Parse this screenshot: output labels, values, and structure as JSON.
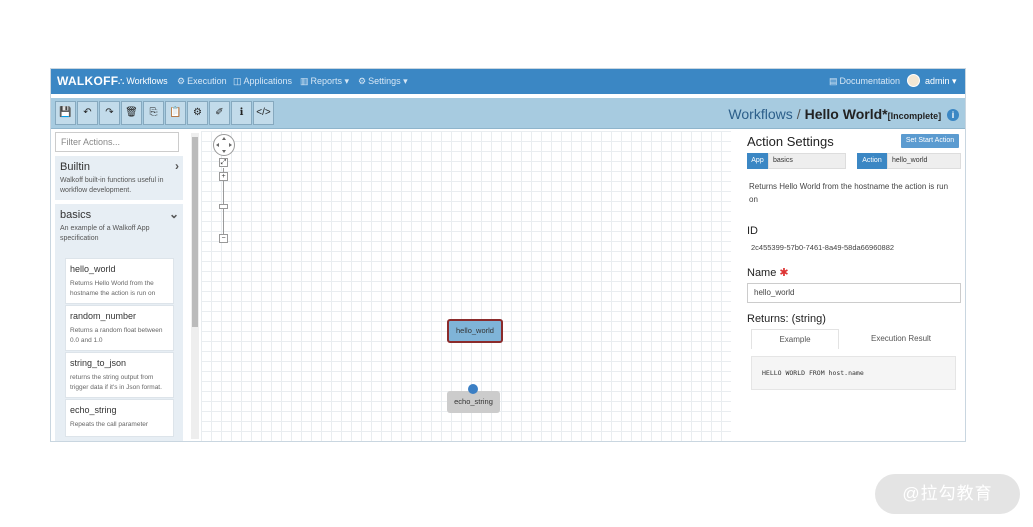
{
  "navbar": {
    "brand": "WALKOFF",
    "items": [
      {
        "icon": "sitemap-icon",
        "glyph": "⛬",
        "label": "Workflows",
        "active": true
      },
      {
        "icon": "gear-icon",
        "glyph": "⚙",
        "label": "Execution"
      },
      {
        "icon": "cube-icon",
        "glyph": "◫",
        "label": "Applications"
      },
      {
        "icon": "bar-chart-icon",
        "glyph": "▥",
        "label": "Reports ▾"
      },
      {
        "icon": "gear-icon",
        "glyph": "⚙",
        "label": "Settings ▾"
      }
    ],
    "documentation": "Documentation",
    "user": "admin ▾"
  },
  "toolbar": {
    "buttons": [
      {
        "name": "save-icon",
        "glyph": "💾"
      },
      {
        "name": "undo-icon",
        "glyph": "↶"
      },
      {
        "name": "redo-icon",
        "glyph": "↷"
      },
      {
        "name": "trash-icon",
        "glyph": "🗑"
      },
      {
        "name": "copy-icon",
        "glyph": "⎘"
      },
      {
        "name": "paste-icon",
        "glyph": "📋"
      },
      {
        "name": "settings-icon",
        "glyph": "⚙"
      },
      {
        "name": "eraser-icon",
        "glyph": "✐"
      },
      {
        "name": "info-icon",
        "glyph": "ℹ"
      },
      {
        "name": "code-icon",
        "glyph": "</>"
      }
    ],
    "breadcrumb": {
      "root": "Workflows",
      "separator": "/",
      "current": "Hello World*",
      "status": "[Incomplete]",
      "info_glyph": "i"
    }
  },
  "left": {
    "filter_placeholder": "Filter Actions...",
    "groups": [
      {
        "title": "Builtin",
        "chevron": "›",
        "desc": "Walkoff built-in functions useful in workflow development."
      },
      {
        "title": "basics",
        "chevron": "⌄",
        "desc": "An example of a Walkoff App specification"
      }
    ],
    "actions": [
      {
        "title": "hello_world",
        "desc": "Returns Hello World from the hostname the action is run on"
      },
      {
        "title": "random_number",
        "desc": "Returns a random float between 0.0 and 1.0"
      },
      {
        "title": "string_to_json",
        "desc": "returns the string output from trigger data if it's in Json format."
      },
      {
        "title": "echo_string",
        "desc": "Repeats the call parameter"
      }
    ]
  },
  "canvas": {
    "zoom_in": "+",
    "zoom_out": "−",
    "nodes": [
      {
        "label": "hello_world"
      },
      {
        "label": "echo_string"
      }
    ]
  },
  "settings": {
    "title": "Action Settings",
    "start_button": "Set Start Action",
    "app_label": "App",
    "app_value": "basics",
    "action_label": "Action",
    "action_value": "hello_world",
    "description": "Returns Hello World from the hostname the action is run on",
    "id_label": "ID",
    "id_value": "2c455399-57b0-7461-8a49-58da66960882",
    "name_label": "Name",
    "required_mark": "✱",
    "name_value": "hello_world",
    "returns_label": "Returns: (string)",
    "tabs": [
      "Example",
      "Execution Result"
    ],
    "example": "HELLO WORLD FROM host.name"
  },
  "watermark": "@拉勾教育"
}
